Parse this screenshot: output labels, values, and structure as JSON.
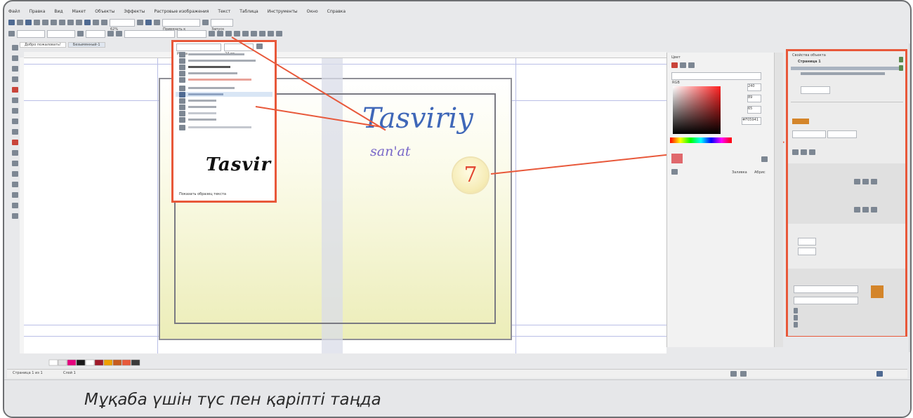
{
  "app": {
    "menu": [
      "Файл",
      "Правка",
      "Вид",
      "Макет",
      "Объекты",
      "Эффекты",
      "Растровые изображения",
      "Текст",
      "Таблица",
      "Инструменты",
      "Окно",
      "Справка"
    ],
    "zoom": "62%",
    "snap_label": "Привязать к",
    "launch_label": "Запуск"
  },
  "document": {
    "tabs": [
      "Добро пожаловать!",
      "Безымянный-1"
    ]
  },
  "font_dropdown": {
    "current_font": "Pecita",
    "current_size": "24 пт",
    "footer": "Показать образец текста",
    "sample_text": "Tasvir"
  },
  "canvas": {
    "script_main": "Tasviriy",
    "script_sub": "san'at",
    "step_number": "7"
  },
  "color_panel": {
    "title": "Цвет",
    "model": "RGB",
    "values": [
      "240",
      "89",
      "65"
    ],
    "hex": "#F05941",
    "fill_button": "Заливка",
    "outline_button": "Абрис"
  },
  "properties_panel": {
    "title": "Свойства объекта",
    "layer_label": "Страница 1",
    "colors": {
      "accent": "#e8583a",
      "swatch": "#d4852a"
    }
  },
  "status": {
    "page_info": "Страница 1 из 1",
    "layer": "Слой 1"
  },
  "palette_colors": [
    "#ffffff",
    "#e2e2e2",
    "#e6007e",
    "#1a1a1a",
    "#ffffff",
    "#a01a2a",
    "#f0a000",
    "#c65a1e",
    "#e8583a",
    "#3a3a3a"
  ],
  "caption": "Мұқаба үшін түс пен қаріпті таңда"
}
